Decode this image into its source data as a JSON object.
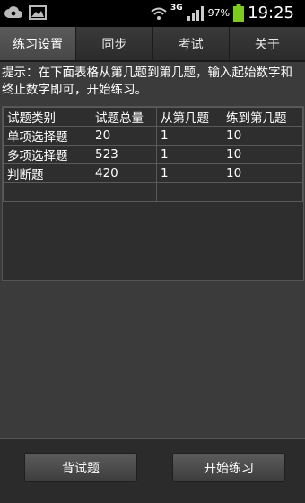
{
  "status": {
    "network": "3G",
    "battery": "97%",
    "time": "19:25"
  },
  "tabs": [
    {
      "label": "练习设置",
      "active": true
    },
    {
      "label": "同步",
      "active": false
    },
    {
      "label": "考试",
      "active": false
    },
    {
      "label": "关于",
      "active": false
    }
  ],
  "hint": "提示：在下面表格从第几题到第几题，输入起始数字和终止数字即可，开始练习。",
  "table": {
    "headers": [
      "试题类别",
      "试题总量",
      "从第几题",
      "练到第几题"
    ],
    "rows": [
      [
        "单项选择题",
        "20",
        "1",
        "10"
      ],
      [
        "多项选择题",
        "523",
        "1",
        "10"
      ],
      [
        "判断题",
        "420",
        "1",
        "10"
      ],
      [
        "",
        "",
        "",
        ""
      ]
    ]
  },
  "buttons": {
    "recite": "背试题",
    "start": "开始练习"
  }
}
